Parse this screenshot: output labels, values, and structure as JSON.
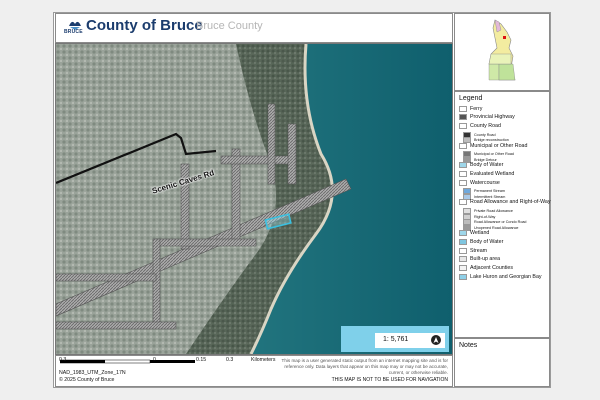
{
  "header": {
    "title": "County of Bruce",
    "subtitle": "Bruce County",
    "logo_text": "BRUCE"
  },
  "map": {
    "road_label": "Scenic Caves Rd"
  },
  "scale": {
    "ratio": "1: 5,761"
  },
  "scalebar": {
    "ticks": [
      "0.3",
      "0",
      "0.15",
      "0.3"
    ],
    "unit": "Kilometers"
  },
  "footer": {
    "projection": "NAD_1983_UTM_Zone_17N",
    "copyright": "© 2025 County of Bruce",
    "disclaimer_1": "This map is a user generated static output from an internet mapping site and is for",
    "disclaimer_2": "reference only. Data layers that appear on this map may or may not be accurate,",
    "disclaimer_3": "current, or otherwise reliable.",
    "disclaimer_bold": "THIS MAP IS NOT TO BE USED FOR NAVIGATION"
  },
  "legend": {
    "title": "Legend",
    "items": [
      {
        "label": "Ferry",
        "sub": false,
        "swatch": "#ffffff"
      },
      {
        "label": "Provincial Highway",
        "sub": false,
        "swatch": "#555555"
      },
      {
        "label": "County Road",
        "sub": false,
        "swatch": "#ffffff"
      },
      {
        "label": "County Road",
        "sub": true,
        "swatch": "#333333"
      },
      {
        "label": "Bridge reconstruction",
        "sub": true,
        "swatch": "#bdbdbd"
      },
      {
        "label": "Municipal or Other Road",
        "sub": false,
        "swatch": "#ffffff"
      },
      {
        "label": "Municipal or Other Road",
        "sub": true,
        "swatch": "#777777"
      },
      {
        "label": "Bridge Detour",
        "sub": true,
        "swatch": "#999999"
      },
      {
        "label": "Body of Water",
        "sub": false,
        "swatch": "#9fd7ea"
      },
      {
        "label": "Evaluated Wetland",
        "sub": false,
        "swatch": "#ffffff"
      },
      {
        "label": "Watercourse",
        "sub": false,
        "swatch": "#ffffff"
      },
      {
        "label": "Permanent Stream",
        "sub": true,
        "swatch": "#6fa8dc"
      },
      {
        "label": "Intermittent Stream",
        "sub": true,
        "swatch": "#a9c9e8"
      },
      {
        "label": "Road Allowance and Right-of-Way",
        "sub": false,
        "swatch": "#ffffff"
      },
      {
        "label": "Private Road Allowance",
        "sub": true,
        "swatch": "#e0e0e0"
      },
      {
        "label": "Right-of-Way",
        "sub": true,
        "swatch": "#d0d0d0"
      },
      {
        "label": "Road Allowance or Condo Road",
        "sub": true,
        "swatch": "#bdbdbd"
      },
      {
        "label": "Unopened Road Allowance",
        "sub": true,
        "swatch": "#9a9a9a"
      },
      {
        "label": "Wetland",
        "sub": false,
        "swatch": "#9fd7ea"
      },
      {
        "label": "Body of Water",
        "sub": false,
        "swatch": "#7fc6e0"
      },
      {
        "label": "Stream",
        "sub": false,
        "swatch": "#ffffff"
      },
      {
        "label": "Built-up area",
        "sub": false,
        "swatch": "#e8e8e8"
      },
      {
        "label": "Adjacent Counties",
        "sub": false,
        "swatch": "#f4f4f4"
      },
      {
        "label": "Lake Huron and Georgian Bay",
        "sub": false,
        "swatch": "#8fd0e8"
      }
    ]
  },
  "notes": {
    "title": "Notes"
  }
}
